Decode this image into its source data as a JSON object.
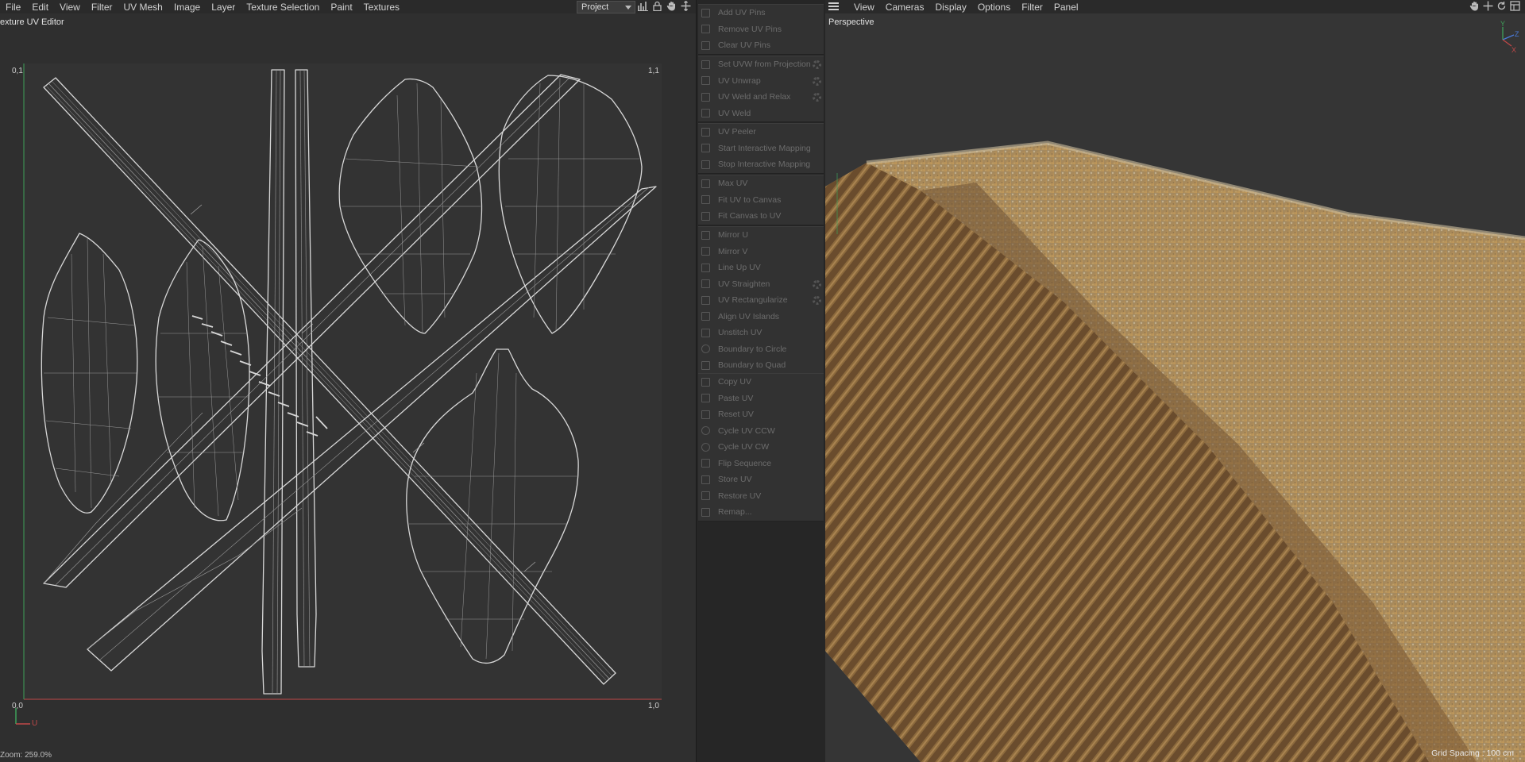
{
  "uv_editor": {
    "menu": [
      "File",
      "Edit",
      "View",
      "Filter",
      "UV Mesh",
      "Image",
      "Layer",
      "Texture Selection",
      "Paint",
      "Textures"
    ],
    "project_select": "Project",
    "toolbar_icons": [
      "histogram-icon",
      "lock-icon",
      "hand-pan-icon",
      "move-icon"
    ],
    "title": "exture UV Editor",
    "corner_labels": {
      "top_left": "0,1",
      "top_right": "1,1",
      "bottom_left": "0,0",
      "bottom_right": "1,0"
    },
    "axis_label": "U",
    "zoom": "Zoom: 259.0%"
  },
  "commands": {
    "groups": [
      [
        {
          "label": "Add UV Pins",
          "icon": "pin-add-icon"
        },
        {
          "label": "Remove UV Pins",
          "icon": "pin-remove-icon"
        },
        {
          "label": "Clear UV Pins",
          "icon": "clear-icon"
        }
      ],
      [
        {
          "label": "Set UVW from Projection",
          "icon": "projection-icon",
          "gear": true
        },
        {
          "label": "UV Unwrap",
          "icon": "unwrap-icon",
          "gear": true
        },
        {
          "label": "UV Weld and Relax",
          "icon": "weld-relax-icon",
          "gear": true
        },
        {
          "label": "UV Weld",
          "icon": "weld-icon"
        }
      ],
      [
        {
          "label": "UV Peeler",
          "icon": "peeler-icon"
        },
        {
          "label": "Start Interactive Mapping",
          "icon": "play-icon"
        },
        {
          "label": "Stop Interactive Mapping",
          "icon": "stop-icon"
        }
      ],
      [
        {
          "label": "Max UV",
          "icon": "max-uv-icon"
        },
        {
          "label": "Fit UV to Canvas",
          "icon": "fit-uv-icon"
        },
        {
          "label": "Fit Canvas to UV",
          "icon": "fit-canvas-icon"
        }
      ],
      [
        {
          "label": "Mirror U",
          "icon": "mirror-u-icon"
        },
        {
          "label": "Mirror V",
          "icon": "mirror-v-icon"
        },
        {
          "label": "Line Up UV",
          "icon": "line-up-icon"
        },
        {
          "label": "UV Straighten",
          "icon": "straighten-icon",
          "gear": true
        },
        {
          "label": "UV Rectangularize",
          "icon": "rectangularize-icon",
          "gear": true
        },
        {
          "label": "Align UV Islands",
          "icon": "align-icon"
        },
        {
          "label": "Unstitch UV",
          "icon": "unstitch-icon"
        },
        {
          "label": "Boundary to Circle",
          "icon": "circle-icon"
        },
        {
          "label": "Boundary to Quad",
          "icon": "quad-icon"
        }
      ],
      [
        {
          "label": "Copy UV",
          "icon": "copy-icon"
        },
        {
          "label": "Paste UV",
          "icon": "paste-icon"
        },
        {
          "label": "Reset UV",
          "icon": "reset-icon"
        },
        {
          "label": "Cycle UV CCW",
          "icon": "cycle-ccw-icon"
        },
        {
          "label": "Cycle UV CW",
          "icon": "cycle-cw-icon"
        },
        {
          "label": "Flip Sequence",
          "icon": "flip-icon"
        },
        {
          "label": "Store UV",
          "icon": "store-icon"
        },
        {
          "label": "Restore UV",
          "icon": "restore-icon"
        },
        {
          "label": "Remap...",
          "icon": "remap-icon"
        }
      ]
    ]
  },
  "viewport": {
    "menu": [
      "View",
      "Cameras",
      "Display",
      "Options",
      "Filter",
      "Panel"
    ],
    "title": "Perspective",
    "grid_spacing": "Grid Spacing : 100 cm",
    "toolbar_icons": [
      "hand-pan-icon",
      "move-icon",
      "rotate-icon",
      "layout-icon"
    ],
    "axis_labels": {
      "y": "Y",
      "z": "Z",
      "x": "X"
    }
  },
  "colors": {
    "u_axis": "#c04848",
    "v_axis": "#3fa05a",
    "wheat_light": "#b69b6a",
    "wheat_dark": "#6b4c2a"
  }
}
